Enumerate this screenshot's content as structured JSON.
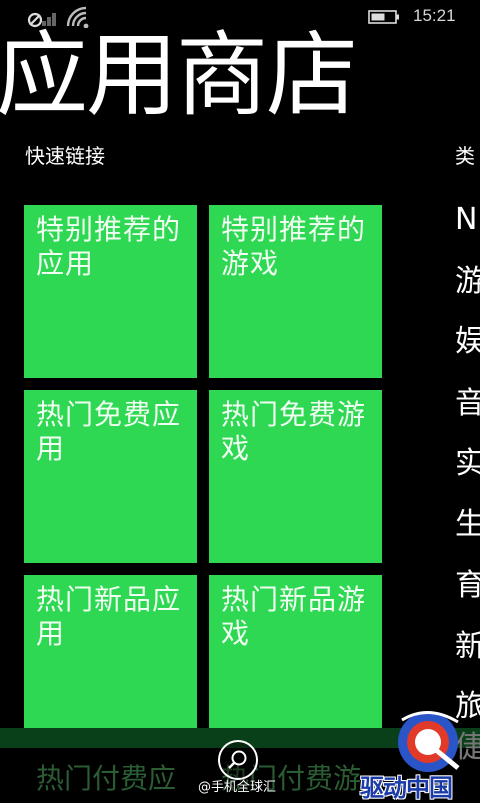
{
  "status": {
    "time": "15:21"
  },
  "header": {
    "title": "应用商店"
  },
  "sections": {
    "quick_links": "快速链接",
    "categories": "类"
  },
  "tiles": [
    {
      "label": "特别推荐的应用"
    },
    {
      "label": "特别推荐的游戏"
    },
    {
      "label": "热门免费应用"
    },
    {
      "label": "热门免费游戏"
    },
    {
      "label": "热门新品应用"
    },
    {
      "label": "热门新品游戏"
    },
    {
      "label": "热门付费应"
    },
    {
      "label": "热门付费游"
    }
  ],
  "categories": [
    "N",
    "游",
    "娱",
    "音",
    "实",
    "生",
    "育",
    "新",
    "旅"
  ],
  "overlay": {
    "watermark": "@手机全球汇",
    "logo_text": "驱动中国",
    "side_ghost": "倢"
  },
  "colors": {
    "tile": "#2ed852",
    "background": "#000000"
  }
}
